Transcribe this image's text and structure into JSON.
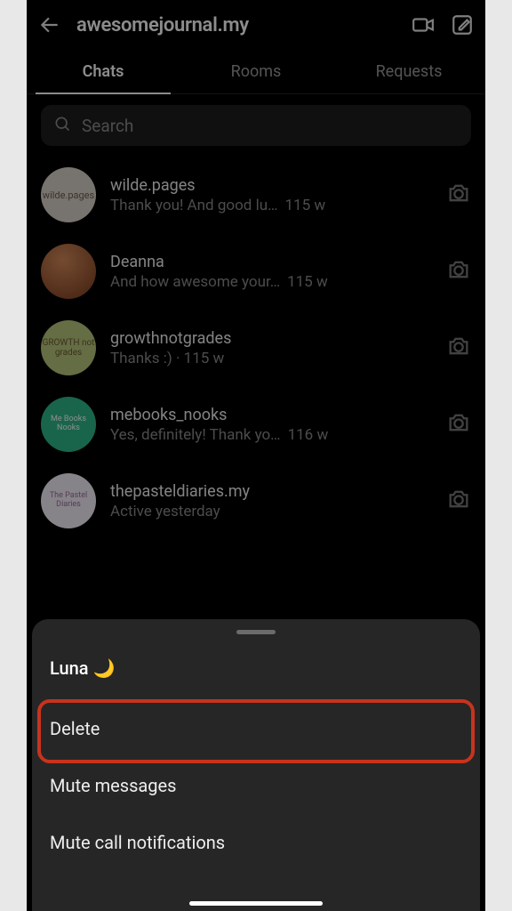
{
  "header": {
    "title": "awesomejournal.my"
  },
  "tabs": [
    {
      "label": "Chats",
      "active": true
    },
    {
      "label": "Rooms",
      "active": false
    },
    {
      "label": "Requests",
      "active": false
    }
  ],
  "search": {
    "placeholder": "Search"
  },
  "chats": [
    {
      "name": "wilde.pages",
      "preview": "Thank you! And good lu…",
      "time": "115 w",
      "avatar_text": "wilde.pages",
      "avatar_class": "av1"
    },
    {
      "name": "Deanna",
      "preview": "And how awesome your…",
      "time": "115 w",
      "avatar_text": "",
      "avatar_class": "av2"
    },
    {
      "name": "growthnotgrades",
      "preview": "Thanks :) · 115 w",
      "time": "",
      "avatar_text": "GROWTH not grades",
      "avatar_class": "av3"
    },
    {
      "name": "mebooks_nooks",
      "preview": "Yes, definitely! Thank yo…",
      "time": "116 w",
      "avatar_text": "Me Books Nooks",
      "avatar_class": "av4"
    },
    {
      "name": "thepasteldiaries.my",
      "preview": "Active yesterday",
      "time": "",
      "avatar_text": "The Pastel Diaries",
      "avatar_class": "av5"
    }
  ],
  "sheet": {
    "title": "Luna 🌙",
    "items": [
      {
        "label": "Delete",
        "highlighted": true
      },
      {
        "label": "Mute messages",
        "highlighted": false
      },
      {
        "label": "Mute call notifications",
        "highlighted": false
      }
    ]
  }
}
